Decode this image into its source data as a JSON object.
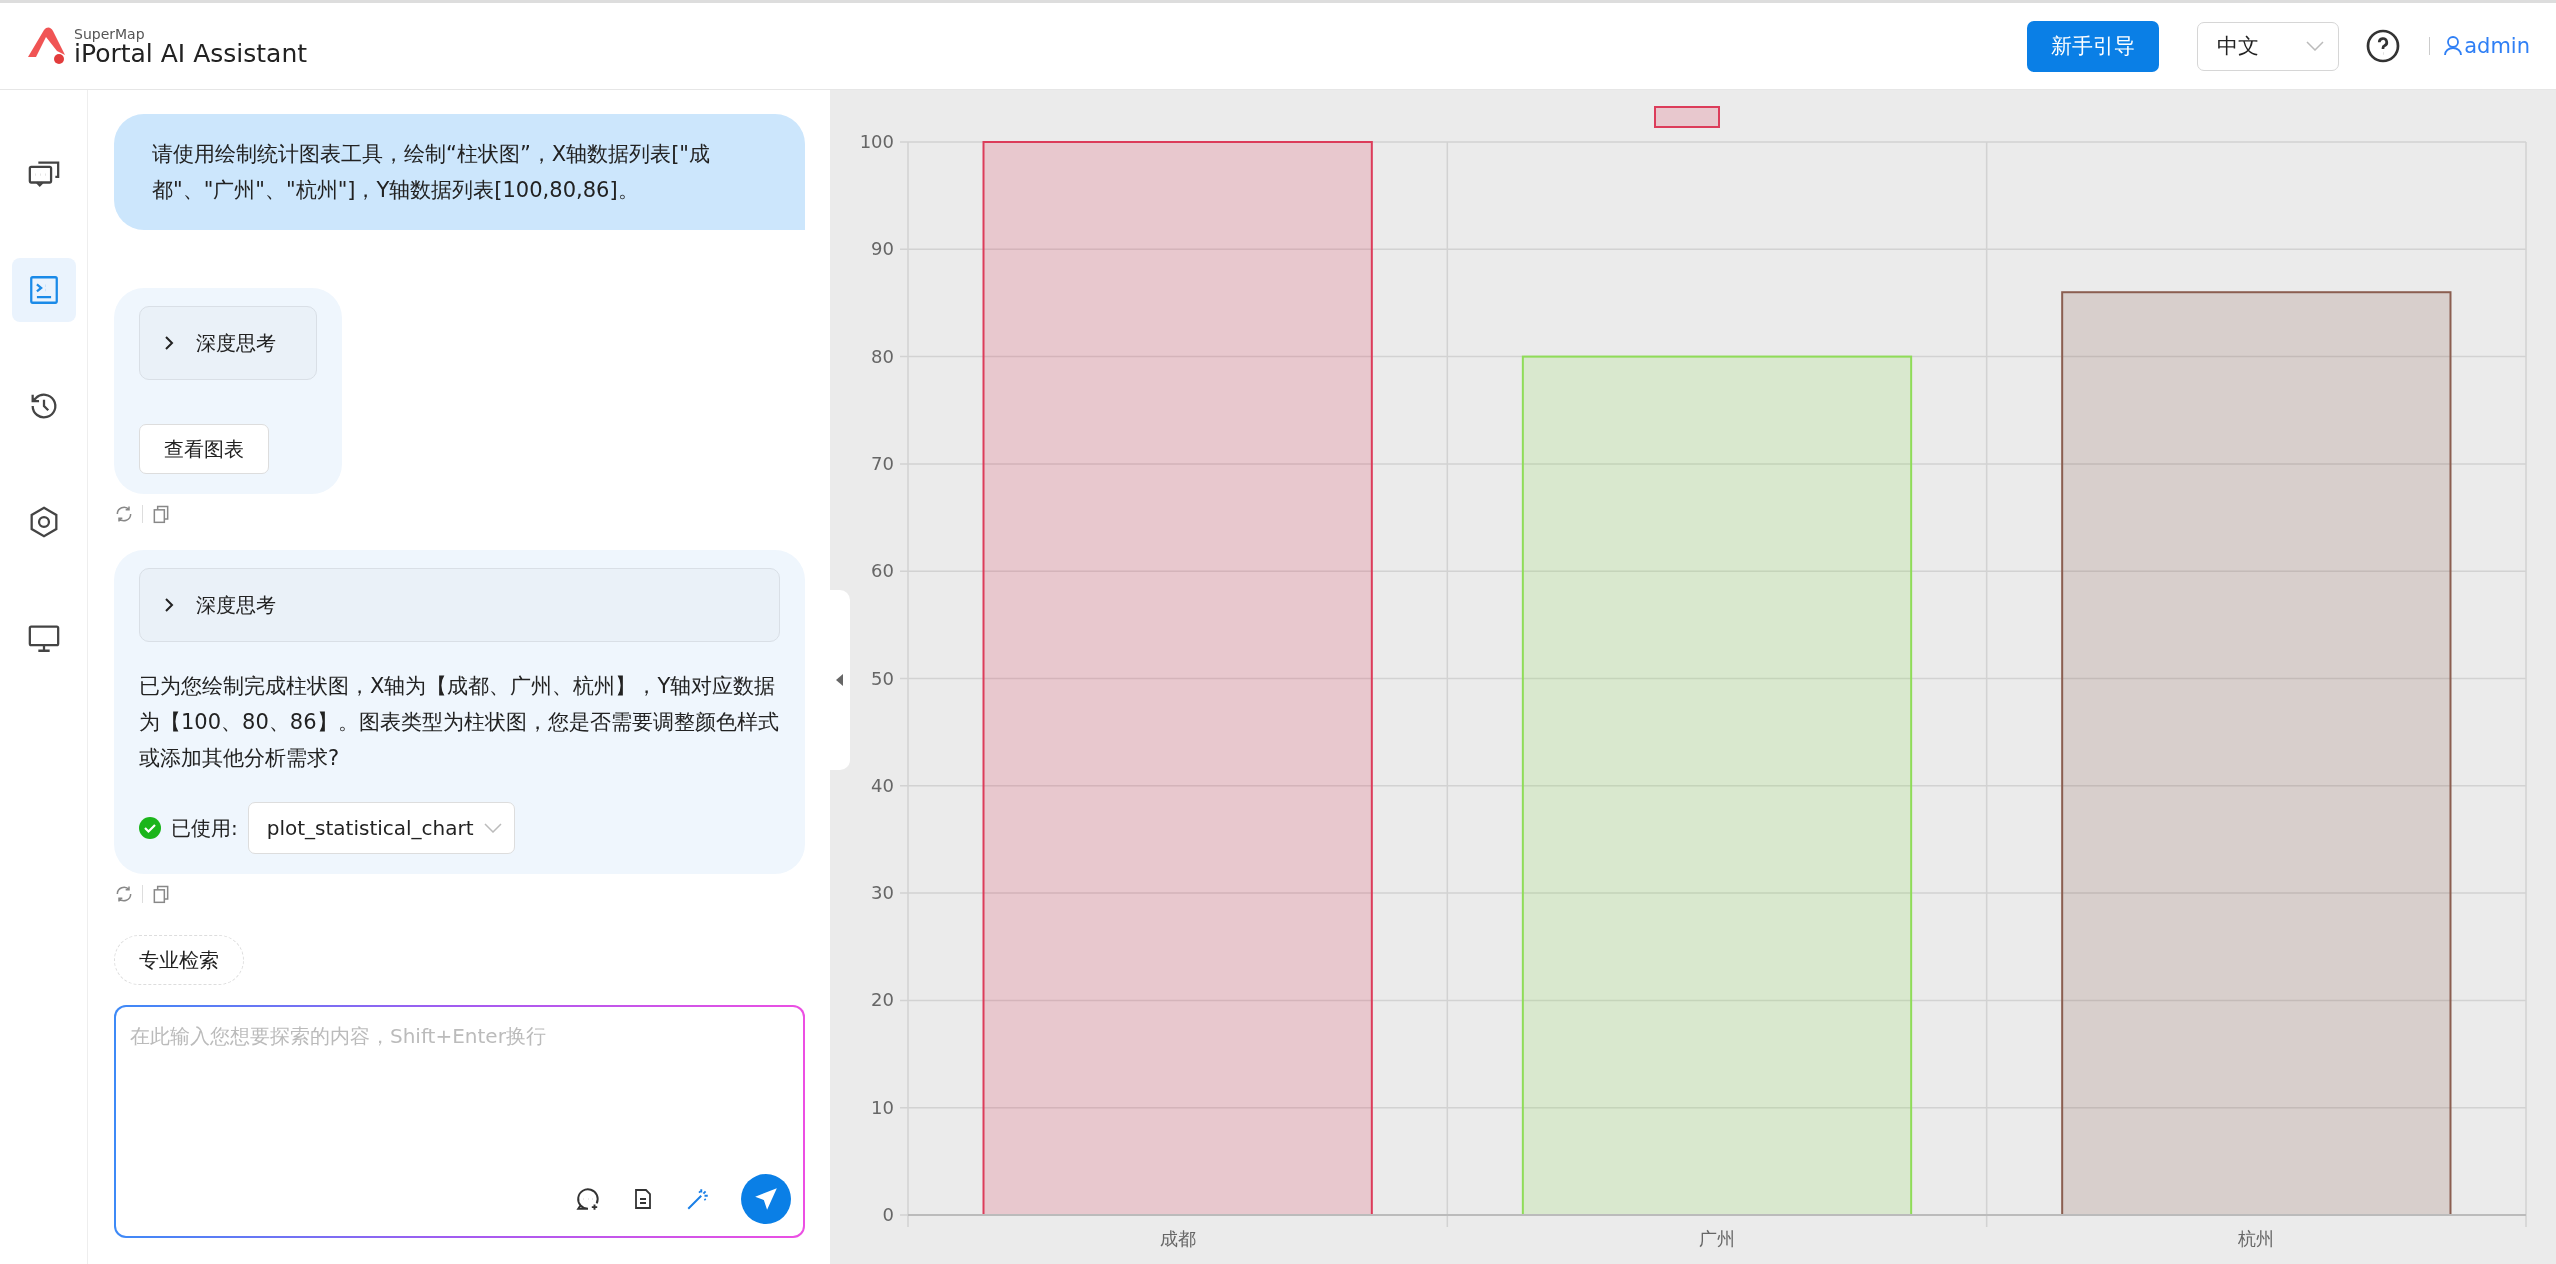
{
  "header": {
    "brand": "SuperMap",
    "product": "iPortal AI Assistant",
    "guide_button": "新手引导",
    "language_select": {
      "value": "中文"
    },
    "user": "admin"
  },
  "rail": [
    {
      "selected": false
    },
    {
      "selected": true
    },
    {
      "selected": false
    },
    {
      "selected": false
    },
    {
      "selected": false
    }
  ],
  "messages": [
    {
      "kind": "user",
      "text": "请使用绘制统计图表工具，绘制“柱状图”，X轴数据列表[\"成都\"、\"广州\"、\"杭州\"]，Y轴数据列表[100,80,86]。"
    },
    {
      "kind": "assistant",
      "thinking": {
        "label": "深度思考",
        "expanded": false
      },
      "button": "查看图表"
    },
    {
      "kind": "assistant",
      "thinking": {
        "label": "深度思考",
        "expanded": false
      },
      "text": "已为您绘制完成柱状图，X轴为【成都、广州、杭州】，Y轴对应数据为【100、80、86】。图表类型为柱状图，您是否需要调整颜色样式或添加其他分析需求?",
      "tool": {
        "label": "已使用:",
        "name": "plot_statistical_chart"
      }
    }
  ],
  "chip": "专业检索",
  "input": {
    "placeholder": "在此输入您想要探索的内容，Shift+Enter换行"
  },
  "chart_data": {
    "type": "bar",
    "categories": [
      "成都",
      "广州",
      "杭州"
    ],
    "series": [
      {
        "color": "#dc3c5a",
        "values": [
          100,
          null,
          null
        ]
      },
      {
        "color": "#8fdc58",
        "values": [
          null,
          80,
          null
        ]
      },
      {
        "color": "#8b5e50",
        "values": [
          null,
          null,
          86
        ]
      }
    ],
    "grid": true,
    "ylim": [
      0,
      100
    ],
    "yticks": [
      0,
      10,
      20,
      30,
      40,
      50,
      60,
      70,
      80,
      90,
      100
    ]
  }
}
